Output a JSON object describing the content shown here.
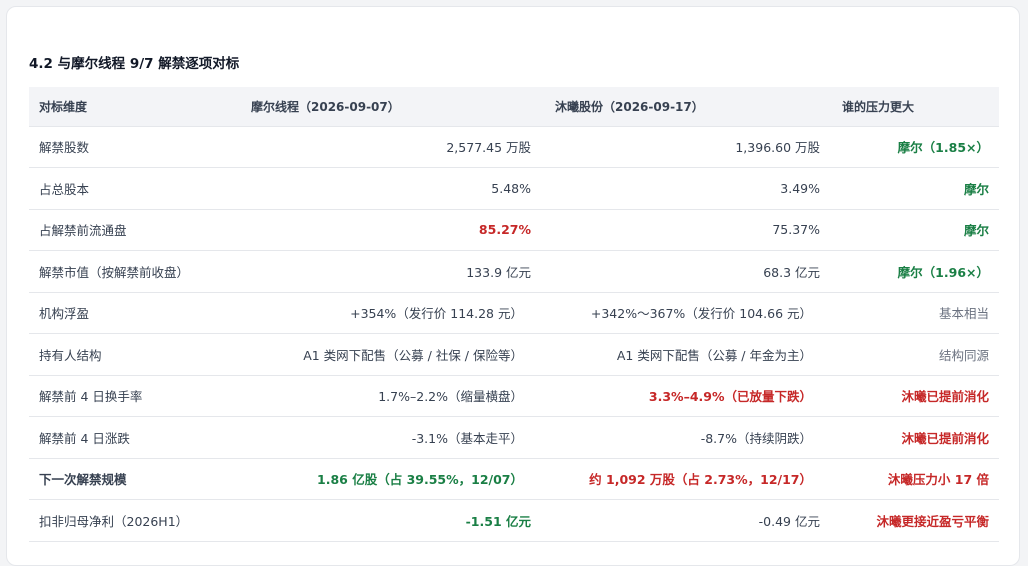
{
  "section": {
    "title": "4.2 与摩尔线程 9/7 解禁逐项对标"
  },
  "colors": {
    "green": "#1a7f45",
    "red": "#c62828",
    "gray": "#6b7280",
    "header_bg": "#f3f4f7"
  },
  "table": {
    "headers": [
      "对标维度",
      "摩尔线程（2026-09-07）",
      "沐曦股份（2026-09-17）",
      "谁的压力更大"
    ],
    "rows": [
      {
        "dim": "解禁股数",
        "a": "2,577.45 万股",
        "b": "1,396.60 万股",
        "verdict": "摩尔（1.85×）"
      },
      {
        "dim": "占总股本",
        "a": "5.48%",
        "b": "3.49%",
        "verdict": "摩尔"
      },
      {
        "dim": "占解禁前流通盘",
        "a": "85.27%",
        "b": "75.37%",
        "verdict": "摩尔"
      },
      {
        "dim": "解禁市值（按解禁前收盘）",
        "a": "133.9 亿元",
        "b": "68.3 亿元",
        "verdict": "摩尔（1.96×）"
      },
      {
        "dim": "机构浮盈",
        "a": "+354%（发行价 114.28 元）",
        "b": "+342%～367%（发行价 104.66 元）",
        "verdict": "基本相当"
      },
      {
        "dim": "持有人结构",
        "a": "A1 类网下配售（公募 / 社保 / 保险等）",
        "b": "A1 类网下配售（公募 / 年金为主）",
        "verdict": "结构同源"
      },
      {
        "dim": "解禁前 4 日换手率",
        "a": "1.7%–2.2%（缩量横盘）",
        "b": "3.3%–4.9%（已放量下跌）",
        "verdict": "沐曦已提前消化"
      },
      {
        "dim": "解禁前 4 日涨跌",
        "a": "-3.1%（基本走平）",
        "b": "-8.7%（持续阴跌）",
        "verdict": "沐曦已提前消化"
      },
      {
        "dim": "下一次解禁规模",
        "a": "1.86 亿股（占 39.55%，12/07）",
        "b": "约 1,092 万股（占 2.73%，12/17）",
        "verdict": "沐曦压力小 17 倍"
      },
      {
        "dim": "扣非归母净利（2026H1）",
        "a": "-1.51 亿元",
        "b": "-0.49 亿元",
        "verdict": "沐曦更接近盈亏平衡"
      }
    ]
  }
}
